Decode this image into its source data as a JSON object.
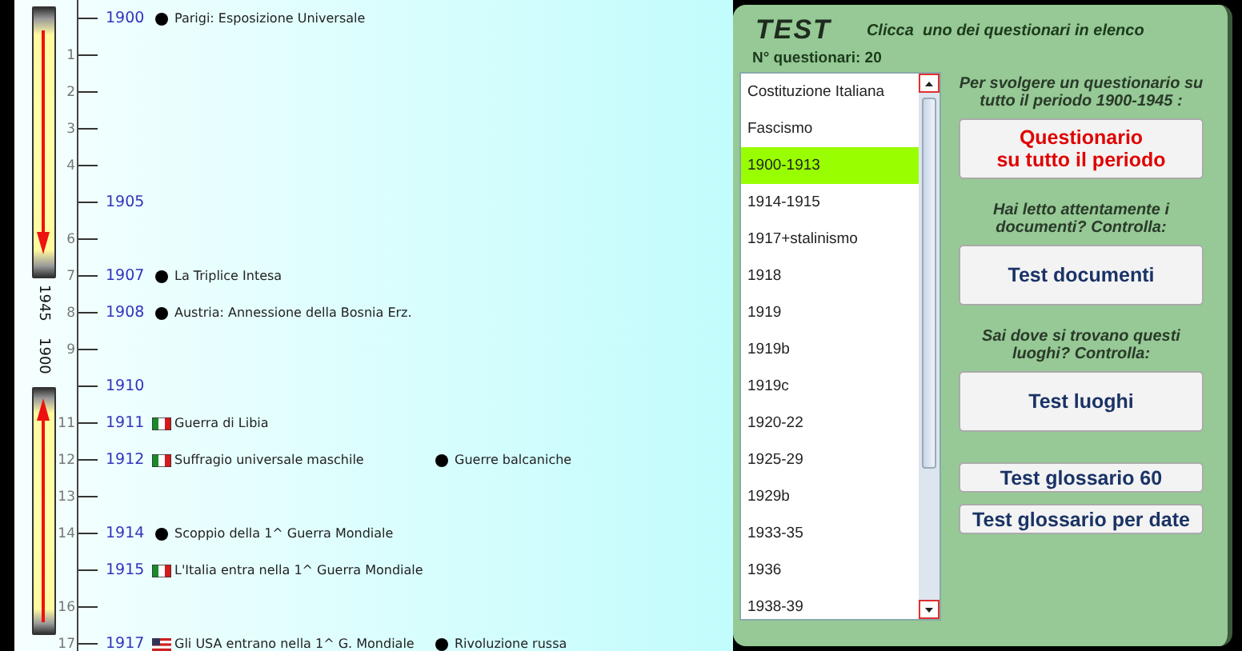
{
  "timeline": {
    "range": {
      "end": "1945",
      "start": "1900"
    },
    "rows": [
      {
        "year": "1900",
        "events": [
          {
            "kind": "dot",
            "text": "Parigi: Esposizione Universale"
          }
        ]
      },
      {
        "number": "1"
      },
      {
        "number": "2"
      },
      {
        "number": "3"
      },
      {
        "number": "4"
      },
      {
        "year": "1905"
      },
      {
        "number": "6"
      },
      {
        "number": "7",
        "year": "1907",
        "events": [
          {
            "kind": "dot",
            "text": "La Triplice Intesa"
          }
        ]
      },
      {
        "number": "8",
        "year": "1908",
        "events": [
          {
            "kind": "dot",
            "text": "Austria: Annessione della Bosnia Erz."
          }
        ]
      },
      {
        "number": "9"
      },
      {
        "year": "1910"
      },
      {
        "number": "11",
        "year": "1911",
        "events": [
          {
            "kind": "flag-it",
            "text": "Guerra di Libia"
          }
        ]
      },
      {
        "number": "12",
        "year": "1912",
        "events": [
          {
            "kind": "flag-it",
            "text": "Suffragio universale maschile"
          },
          {
            "kind": "dot",
            "text": "Guerre balcaniche"
          }
        ]
      },
      {
        "number": "13"
      },
      {
        "number": "14",
        "year": "1914",
        "events": [
          {
            "kind": "dot",
            "text": "Scoppio della 1^ Guerra Mondiale"
          }
        ]
      },
      {
        "year": "1915",
        "events": [
          {
            "kind": "flag-it",
            "text": "L'Italia entra nella 1^ Guerra Mondiale"
          }
        ]
      },
      {
        "number": "16"
      },
      {
        "number": "17",
        "year": "1917",
        "events": [
          {
            "kind": "flag-us",
            "text": "Gli USA entrano nella 1^ G. Mondiale"
          },
          {
            "kind": "dot",
            "text": "Rivoluzione russa"
          }
        ]
      }
    ]
  },
  "test_panel": {
    "title": "TEST",
    "instruction": "Clicca  uno dei questionari in elenco",
    "count": "N° questionari: 20",
    "list": [
      {
        "label": "Costituzione Italiana",
        "selected": false
      },
      {
        "label": "Fascismo",
        "selected": false
      },
      {
        "label": "1900-1913",
        "selected": true
      },
      {
        "label": "1914-1915",
        "selected": false
      },
      {
        "label": "1917+stalinismo",
        "selected": false
      },
      {
        "label": "1918",
        "selected": false
      },
      {
        "label": "1919",
        "selected": false
      },
      {
        "label": "1919b",
        "selected": false
      },
      {
        "label": "1919c",
        "selected": false
      },
      {
        "label": "1920-22",
        "selected": false
      },
      {
        "label": "1925-29",
        "selected": false
      },
      {
        "label": "1929b",
        "selected": false
      },
      {
        "label": "1933-35",
        "selected": false
      },
      {
        "label": "1936",
        "selected": false
      },
      {
        "label": "1938-39",
        "selected": false
      }
    ],
    "actions": [
      {
        "kind": "big",
        "prompt": "Per svolgere un questionario su tutto il periodo  1900-1945 :",
        "label": "Questionario\nsu tutto il periodo",
        "color": "#e00000"
      },
      {
        "kind": "big",
        "prompt": "Hai letto attentamente i documenti? Controlla:",
        "label": "Test documenti",
        "color": "#1a3366"
      },
      {
        "kind": "big",
        "prompt": "Sai dove si trovano questi luoghi? Controlla:",
        "label": "Test luoghi",
        "color": "#1a3366"
      },
      {
        "kind": "small",
        "label": "Test glossario 60",
        "color": "#1a3366"
      },
      {
        "kind": "small",
        "label": "Test glossario per date",
        "color": "#1a3366"
      }
    ]
  }
}
